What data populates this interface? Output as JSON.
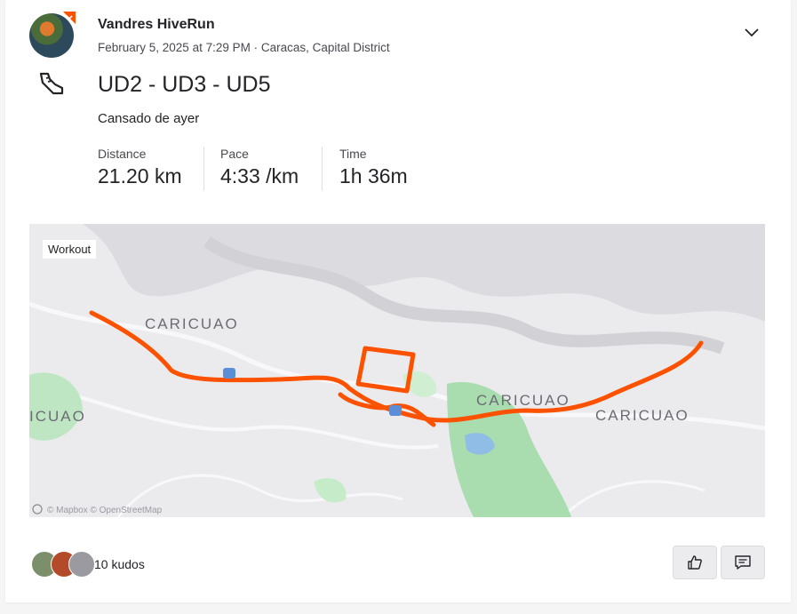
{
  "activity": {
    "athlete_name": "Vandres HiveRun",
    "meta": "February 5, 2025 at 7:29 PM · Caracas, Capital District",
    "title": "UD2 - UD3 - UD5",
    "description": "Cansado de ayer"
  },
  "stats": [
    {
      "label": "Distance",
      "value": "21.20 km"
    },
    {
      "label": "Pace",
      "value": "4:33 /km"
    },
    {
      "label": "Time",
      "value": "1h 36m"
    }
  ],
  "map": {
    "badge": "Workout",
    "place_labels": [
      "CARICUAO",
      "CARICUAO",
      "CARICUAO",
      "ICUAO"
    ],
    "attribution": "© Mapbox © OpenStreetMap",
    "route_color": "#fc5200"
  },
  "kudos": {
    "text": "10 kudos"
  },
  "icons": {
    "chevron": "chevron-down-icon",
    "shoe": "run-shoe-icon",
    "kudos_button": "thumbs-up-icon",
    "comment_button": "comment-icon"
  }
}
